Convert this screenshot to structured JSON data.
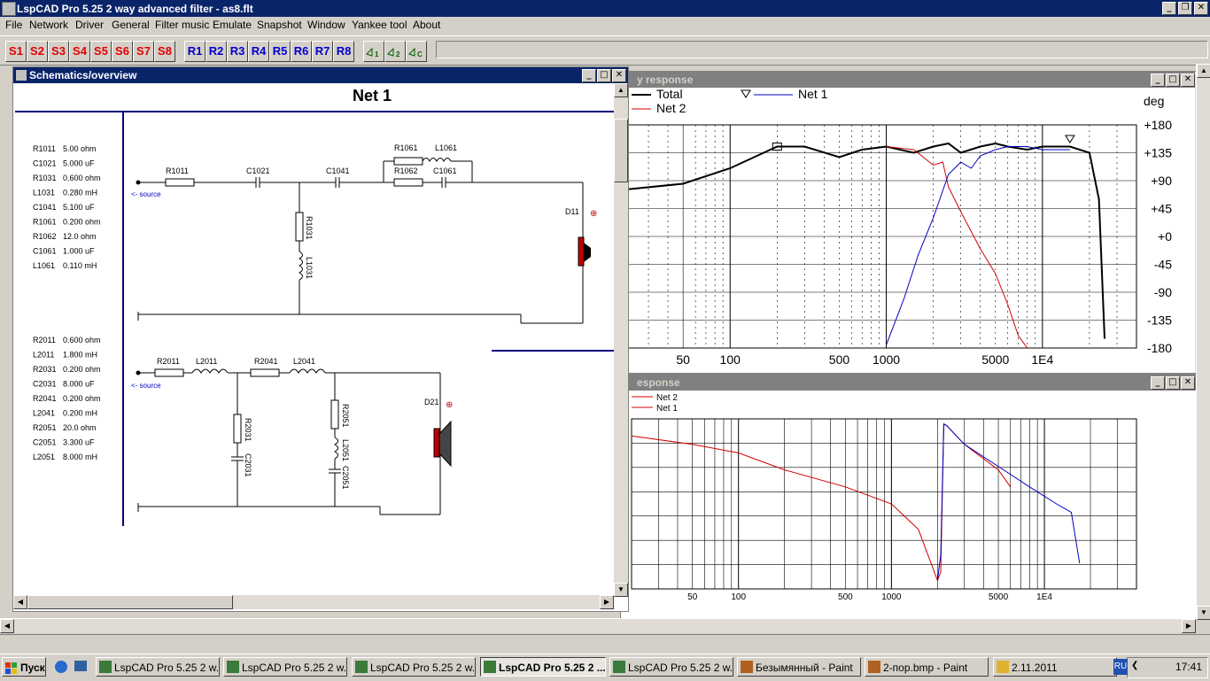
{
  "app": {
    "title": "LspCAD Pro 5.25 2 way advanced filter - as8.flt",
    "win_min": "_",
    "win_restore": "❐",
    "win_close": "✕"
  },
  "menu": [
    "File",
    "Network",
    "Driver",
    "General",
    "Filter music",
    "Emulate",
    "Snapshot",
    "Window",
    "Yankee tool",
    "About"
  ],
  "toolbar": {
    "s_buttons": [
      "S1",
      "S2",
      "S3",
      "S4",
      "S5",
      "S6",
      "S7",
      "S8"
    ],
    "r_buttons": [
      "R1",
      "R2",
      "R3",
      "R4",
      "R5",
      "R6",
      "R7",
      "R8"
    ],
    "graph_buttons": [
      "1",
      "2",
      "C"
    ]
  },
  "schematic": {
    "title": "Schematics/overview",
    "net_title": "Net 1",
    "source_label": "<- source",
    "net1_components": [
      {
        "name": "R1011",
        "value": "5.00 ohm"
      },
      {
        "name": "C1021",
        "value": "5.000 uF"
      },
      {
        "name": "R1031",
        "value": "0.600 ohm"
      },
      {
        "name": "L1031",
        "value": "0.280 mH"
      },
      {
        "name": "C1041",
        "value": "5.100 uF"
      },
      {
        "name": "R1061",
        "value": "0.200 ohm"
      },
      {
        "name": "R1062",
        "value": "12.0 ohm"
      },
      {
        "name": "C1061",
        "value": "1.000 uF"
      },
      {
        "name": "L1061",
        "value": "0.110 mH"
      }
    ],
    "net2_components": [
      {
        "name": "R2011",
        "value": "0.600 ohm"
      },
      {
        "name": "L2011",
        "value": "1.800 mH"
      },
      {
        "name": "R2031",
        "value": "0.200 ohm"
      },
      {
        "name": "C2031",
        "value": "8.000 uF"
      },
      {
        "name": "R2041",
        "value": "0.200 ohm"
      },
      {
        "name": "L2041",
        "value": "0.200 mH"
      },
      {
        "name": "R2051",
        "value": "20.0 ohm"
      },
      {
        "name": "C2051",
        "value": "3.300 uF"
      },
      {
        "name": "L2051",
        "value": "8.000 mH"
      }
    ],
    "net1_labels": {
      "r1011": "R1011",
      "c1021": "C1021",
      "c1041": "C1041",
      "r1061": "R1061",
      "l1061": "L1061",
      "r1062": "R1062",
      "c1061": "C1061",
      "r1031": "R1031",
      "l1031": "L1031",
      "driver": "D11"
    },
    "net2_labels": {
      "r2011": "R2011",
      "l2011": "L2011",
      "r2041": "R2041",
      "l2041": "L2041",
      "r2031": "R2031",
      "c2031": "C2031",
      "r2051": "R2051",
      "l2051": "L2051",
      "c2051": "C2051",
      "driver": "D21"
    }
  },
  "phase_window": {
    "title": "y response",
    "legend": [
      "Total",
      "Net 2",
      "Net 1"
    ],
    "ylabel": "deg",
    "yticks": [
      "+180",
      "+135",
      "+90",
      "+45",
      "+0",
      "-45",
      "-90",
      "-135",
      "-180"
    ],
    "xticks": [
      "50",
      "100",
      "500",
      "1000",
      "5000",
      "1E4"
    ]
  },
  "freq_window": {
    "title": "esponse",
    "legend": [
      "Net 2",
      "Net 1"
    ],
    "xticks": [
      "50",
      "100",
      "500",
      "1000",
      "5000",
      "1E4"
    ]
  },
  "chart_data": [
    {
      "type": "line",
      "title": "",
      "ylabel": "deg",
      "ylim": [
        -180,
        180
      ],
      "xscale": "log",
      "xlim": [
        20,
        40000
      ],
      "series": [
        {
          "name": "Total",
          "color": "#000000",
          "x": [
            20,
            50,
            100,
            200,
            300,
            500,
            700,
            1000,
            1500,
            2000,
            2500,
            3000,
            4000,
            5000,
            6000,
            8000,
            10000,
            15000,
            20000,
            23000,
            25000
          ],
          "y": [
            75,
            85,
            110,
            145,
            145,
            128,
            140,
            145,
            135,
            145,
            150,
            135,
            145,
            150,
            145,
            140,
            145,
            145,
            135,
            60,
            -165
          ]
        },
        {
          "name": "Net 2",
          "color": "#d00000",
          "x": [
            1000,
            1500,
            2000,
            2300,
            2500,
            3000,
            4000,
            5000,
            6000,
            7000,
            8000
          ],
          "y": [
            145,
            140,
            115,
            120,
            80,
            40,
            -20,
            -60,
            -110,
            -160,
            -180
          ]
        },
        {
          "name": "Net 1",
          "color": "#0000c0",
          "x": [
            1000,
            1300,
            1600,
            2000,
            2500,
            3000,
            3500,
            4000,
            5000,
            6000,
            8000,
            10000,
            15000
          ],
          "y": [
            -175,
            -100,
            -30,
            30,
            100,
            120,
            110,
            130,
            140,
            145,
            145,
            140,
            140
          ]
        }
      ]
    },
    {
      "type": "line",
      "title": "",
      "xscale": "log",
      "xlim": [
        20,
        40000
      ],
      "series": [
        {
          "name": "Net 2",
          "color": "#d00000",
          "x": [
            20,
            50,
            100,
            200,
            500,
            1000,
            1500,
            2000,
            2100,
            2200,
            2300,
            3000,
            5000,
            6000
          ],
          "y": [
            0.9,
            0.85,
            0.8,
            0.7,
            0.6,
            0.5,
            0.35,
            0.05,
            0.1,
            0.97,
            0.96,
            0.85,
            0.7,
            0.6
          ]
        },
        {
          "name": "Net 1",
          "color": "#0000c0",
          "x": [
            2000,
            2100,
            2200,
            2300,
            3000,
            5000,
            8000,
            12000,
            15000,
            17000
          ],
          "y": [
            0.05,
            0.2,
            0.97,
            0.96,
            0.85,
            0.72,
            0.6,
            0.5,
            0.45,
            0.15
          ]
        }
      ]
    }
  ],
  "taskbar": {
    "start": "Пуск",
    "tasks": [
      "LspCAD Pro 5.25 2 w...",
      "LspCAD Pro 5.25 2 w...",
      "LspCAD Pro 5.25 2 w...",
      "LspCAD Pro 5.25 2 ...",
      "LspCAD Pro 5.25 2 w...",
      "Безымянный - Paint",
      "2-пор.bmp - Paint",
      "2.11.2011"
    ],
    "lang": "RU",
    "time": "17:41"
  }
}
